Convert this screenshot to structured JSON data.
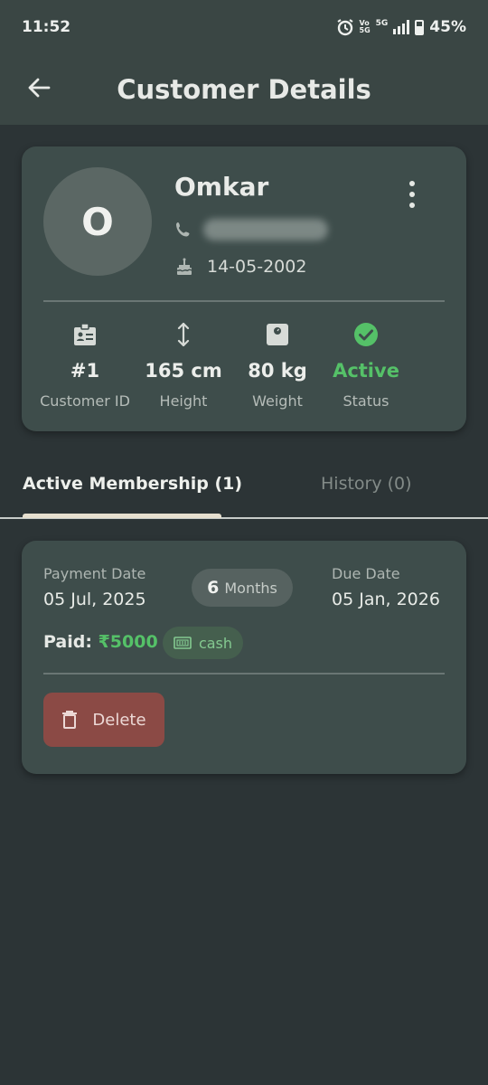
{
  "status_bar": {
    "time": "11:52",
    "network_top": "Vo",
    "network_bottom": "5G",
    "signal_label": "5G",
    "battery": "45%"
  },
  "app_bar": {
    "title": "Customer Details",
    "back_icon": "arrow-left-icon"
  },
  "customer": {
    "initial": "O",
    "name": "Omkar",
    "phone": "",
    "dob": "14-05-2002",
    "stats": [
      {
        "icon": "id-badge-icon",
        "value": "#1",
        "label": "Customer ID"
      },
      {
        "icon": "height-arrows-icon",
        "value": "165 cm",
        "label": "Height"
      },
      {
        "icon": "scale-icon",
        "value": "80 kg",
        "label": "Weight"
      },
      {
        "icon": "check-circle-icon",
        "value": "Active",
        "label": "Status"
      }
    ]
  },
  "tabs": [
    {
      "label": "Active Membership (1)",
      "active": true
    },
    {
      "label": "History (0)",
      "active": false
    }
  ],
  "membership": {
    "payment_date_label": "Payment Date",
    "payment_date": "05 Jul, 2025",
    "duration_value": "6",
    "duration_unit": "Months",
    "due_date_label": "Due Date",
    "due_date": "05 Jan, 2026",
    "paid_label": "Paid:",
    "paid_amount": "₹5000",
    "payment_mode": "cash",
    "delete_label": "Delete"
  },
  "colors": {
    "background": "#2c3436",
    "bar": "#3a4644",
    "card": "#3e4d4b",
    "accent_green": "#55c168",
    "delete": "#8b4a45"
  }
}
